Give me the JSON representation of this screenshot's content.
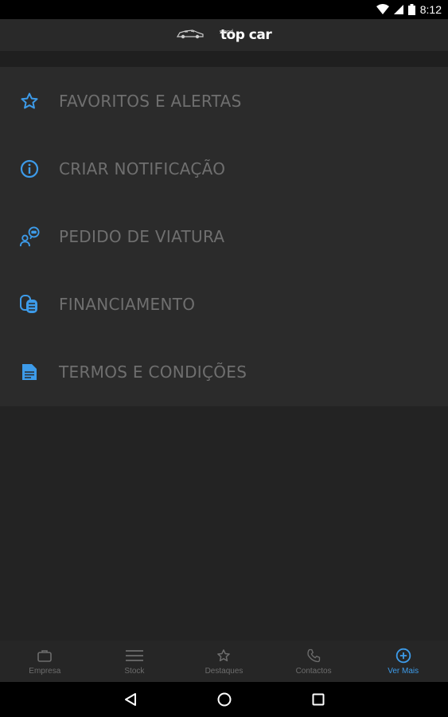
{
  "status_bar": {
    "time": "8:12",
    "icons": [
      "wifi-icon",
      "signal-icon",
      "battery-icon"
    ]
  },
  "app_bar": {
    "logo_small": "stand",
    "logo_text": "top car"
  },
  "menu": {
    "items": [
      {
        "label": "FAVORITOS E ALERTAS",
        "icon": "star-icon"
      },
      {
        "label": "CRIAR NOTIFICAÇÃO",
        "icon": "info-icon"
      },
      {
        "label": "PEDIDO DE VIATURA",
        "icon": "person-car-icon"
      },
      {
        "label": "FINANCIAMENTO",
        "icon": "coins-icon"
      },
      {
        "label": "TERMOS E CONDIÇÕES",
        "icon": "document-icon"
      }
    ]
  },
  "bottom_nav": {
    "items": [
      {
        "label": "Empresa",
        "icon": "briefcase-icon"
      },
      {
        "label": "Stock",
        "icon": "list-icon"
      },
      {
        "label": "Destaques",
        "icon": "star-icon"
      },
      {
        "label": "Contactos",
        "icon": "phone-icon"
      },
      {
        "label": "Ver Mais",
        "icon": "plus-circle-icon",
        "active": true
      }
    ]
  },
  "colors": {
    "accent": "#3d9be9",
    "background": "#232323",
    "menu_background": "#2b2b2b",
    "menu_text": "#6f6f6f"
  }
}
